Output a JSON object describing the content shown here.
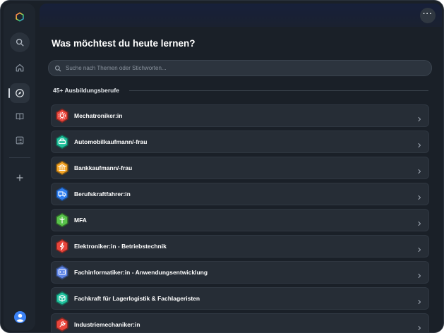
{
  "header": {
    "title": "Was möchtest du heute lernen?"
  },
  "search": {
    "placeholder": "Suche nach Themen oder Stichworten..."
  },
  "section": {
    "label": "45+ Ausbildungsberufe"
  },
  "sidebar": {
    "items": [
      {
        "name": "logo",
        "icon": "hexagon-logo-icon"
      },
      {
        "name": "search",
        "icon": "search-icon"
      },
      {
        "name": "home",
        "icon": "home-icon"
      },
      {
        "name": "explore",
        "icon": "compass-icon",
        "active": true
      },
      {
        "name": "library",
        "icon": "book-icon"
      },
      {
        "name": "lists",
        "icon": "checklist-icon"
      },
      {
        "name": "add",
        "icon": "plus-icon"
      },
      {
        "name": "profile",
        "icon": "user-avatar-icon"
      }
    ]
  },
  "topbar": {
    "more_icon": "more-dots-icon"
  },
  "professions": [
    {
      "label": "Mechatroniker:in",
      "color": "#e8453c",
      "icon": "gear-icon"
    },
    {
      "label": "Automobilkaufmann/-frau",
      "color": "#1fbf9a",
      "icon": "car-icon"
    },
    {
      "label": "Bankkaufmann/-frau",
      "color": "#f3a425",
      "icon": "bank-icon"
    },
    {
      "label": "Berufskraftfahrer:in",
      "color": "#2f7ff0",
      "icon": "truck-icon"
    },
    {
      "label": "MFA",
      "color": "#58c24a",
      "icon": "medical-icon"
    },
    {
      "label": "Elektroniker:in - Betriebstechnik",
      "color": "#e8453c",
      "icon": "bolt-icon"
    },
    {
      "label": "Fachinformatiker:in - Anwendungsentwicklung",
      "color": "#5f86e8",
      "icon": "code-icon"
    },
    {
      "label": "Fachkraft für Lagerlogistik & Fachlageristen",
      "color": "#22c3a0",
      "icon": "box-icon"
    },
    {
      "label": "Industriemechaniker:in",
      "color": "#e8453c",
      "icon": "wrench-icon"
    }
  ],
  "colors": {
    "background": "#1a2028",
    "card": "#262d36",
    "accent_avatar": "#3b82f6"
  }
}
